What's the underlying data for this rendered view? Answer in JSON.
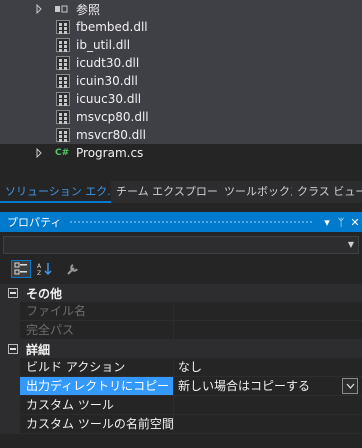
{
  "solution_tree": {
    "references_label": "参照",
    "files": [
      {
        "label": "fbembed.dll"
      },
      {
        "label": "ib_util.dll"
      },
      {
        "label": "icudt30.dll"
      },
      {
        "label": "icuin30.dll"
      },
      {
        "label": "icuuc30.dll"
      },
      {
        "label": "msvcp80.dll"
      },
      {
        "label": "msvcr80.dll"
      }
    ],
    "program_label": "Program.cs",
    "cs_glyph": "C#"
  },
  "tabs": [
    {
      "label": "ソリューション エク...",
      "active": true
    },
    {
      "label": "チーム エクスプロー...",
      "active": false
    },
    {
      "label": "ツールボックス",
      "active": false
    },
    {
      "label": "クラス ビュー",
      "active": false
    }
  ],
  "properties": {
    "title": "プロパティ",
    "pin_glyph": "ᛘ",
    "close_glyph": "✕",
    "menu_glyph": "▾",
    "categories": [
      {
        "name": "その他",
        "rows": [
          {
            "name": "ファイル名",
            "value": "",
            "disabled": true
          },
          {
            "name": "完全パス",
            "value": "",
            "disabled": true
          }
        ]
      },
      {
        "name": "詳細",
        "rows": [
          {
            "name": "ビルド アクション",
            "value": "なし"
          },
          {
            "name": "出力ディレクトリにコピー",
            "value": "新しい場合はコピーする",
            "selected": true
          },
          {
            "name": "カスタム ツール",
            "value": ""
          },
          {
            "name": "カスタム ツールの名前空間",
            "value": ""
          }
        ]
      }
    ]
  },
  "colors": {
    "accent": "#007acc",
    "selection": "#3399ff",
    "background": "#252526"
  }
}
